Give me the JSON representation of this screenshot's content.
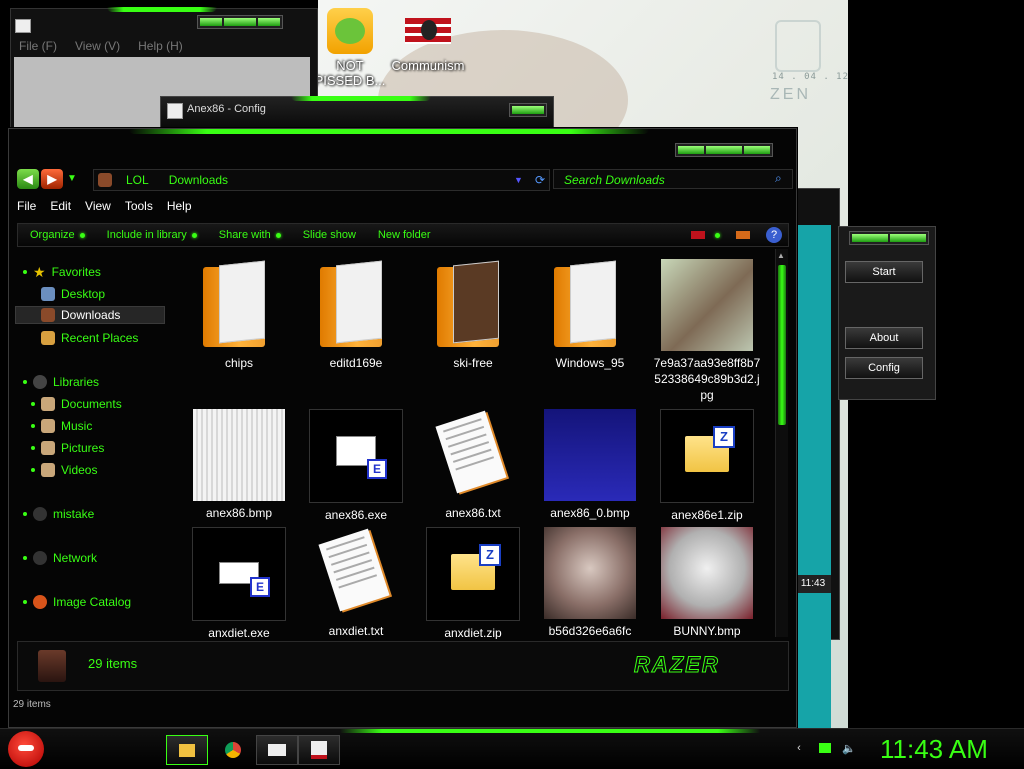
{
  "desktop": {
    "icons": [
      {
        "label": "NOT PISSED B...",
        "icon": "angry-birds-pig-icon"
      },
      {
        "label": "Communism",
        "icon": "communism-flag-icon"
      }
    ],
    "wallpaper_text": {
      "date": "14 . 04 . 12",
      "word": "ZEN"
    }
  },
  "bg_window": {
    "menu": [
      "File (F)",
      "View (V)",
      "Help (H)"
    ]
  },
  "config_window": {
    "title": "Anex86 - Config"
  },
  "side_panel": {
    "buttons": [
      "Start",
      "About",
      "Config"
    ],
    "time": "11:43"
  },
  "explorer": {
    "breadcrumb": [
      "LOL",
      "Downloads"
    ],
    "search_placeholder": "Search Downloads",
    "menu": [
      "File",
      "Edit",
      "View",
      "Tools",
      "Help"
    ],
    "commands": [
      "Organize",
      "Include in library",
      "Share with",
      "Slide show",
      "New folder"
    ],
    "nav": {
      "favorites_label": "Favorites",
      "favorites": [
        "Desktop",
        "Downloads",
        "Recent Places"
      ],
      "libraries_label": "Libraries",
      "libraries": [
        "Documents",
        "Music",
        "Pictures",
        "Videos"
      ],
      "mistake": "mistake",
      "network": "Network",
      "image_catalog": "Image Catalog"
    },
    "files": [
      {
        "name": "chips",
        "type": "folder"
      },
      {
        "name": "editd169e",
        "type": "folder"
      },
      {
        "name": "ski-free",
        "type": "folder"
      },
      {
        "name": "Windows_95",
        "type": "folder"
      },
      {
        "name": "7e9a37aa93e8ff8b752338649c89b3d2.jpg",
        "type": "image"
      },
      {
        "name": "anex86.bmp",
        "type": "bmp"
      },
      {
        "name": "anex86.exe",
        "type": "exe"
      },
      {
        "name": "anex86.txt",
        "type": "txt"
      },
      {
        "name": "anex86_0.bmp",
        "type": "bmp-blue"
      },
      {
        "name": "anex86e1.zip",
        "type": "zip"
      },
      {
        "name": "anxdiet.exe",
        "type": "exe"
      },
      {
        "name": "anxdiet.txt",
        "type": "txt"
      },
      {
        "name": "anxdiet.zip",
        "type": "zip"
      },
      {
        "name": "b56d326e6a6fc",
        "type": "image"
      },
      {
        "name": "BUNNY.bmp",
        "type": "image"
      }
    ],
    "details_count": "29 items",
    "status_count": "29 items",
    "brand": "RAZER"
  },
  "taskbar": {
    "clock": "11:43 AM"
  },
  "colors": {
    "accent": "#39ff14",
    "background": "#000000"
  }
}
